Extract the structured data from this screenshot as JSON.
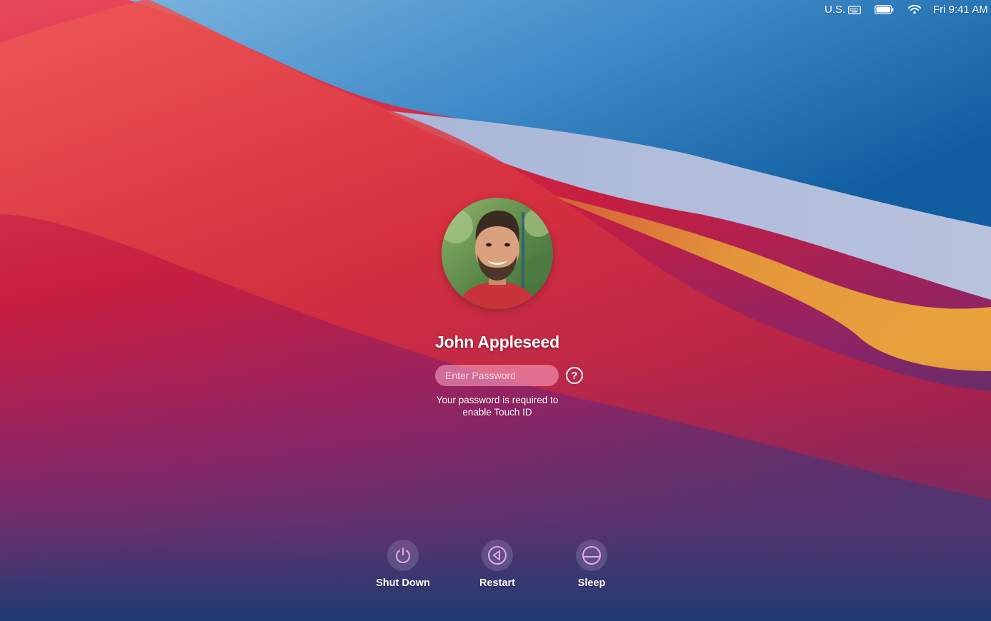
{
  "menubar": {
    "keyboard_layout": "U.S.",
    "keyboard_icon": "keyboard-icon",
    "battery_icon": "battery-icon",
    "wifi_icon": "wifi-icon",
    "clock": "Fri 9:41 AM"
  },
  "login": {
    "user_name": "John Appleseed",
    "avatar_icon": "user-avatar-photo",
    "password_placeholder": "Enter Password",
    "password_value": "",
    "help_label": "?",
    "hint_line1": "Your password is required to",
    "hint_line2": "enable Touch ID"
  },
  "actions": [
    {
      "label": "Shut Down",
      "icon": "power-icon"
    },
    {
      "label": "Restart",
      "icon": "restart-icon"
    },
    {
      "label": "Sleep",
      "icon": "sleep-icon"
    }
  ],
  "colors": {
    "wallpaper_red": "#d42a45",
    "wallpaper_blue": "#1a6fb0",
    "wallpaper_orange": "#e89a3c",
    "action_icon": "#e6a6f0"
  }
}
